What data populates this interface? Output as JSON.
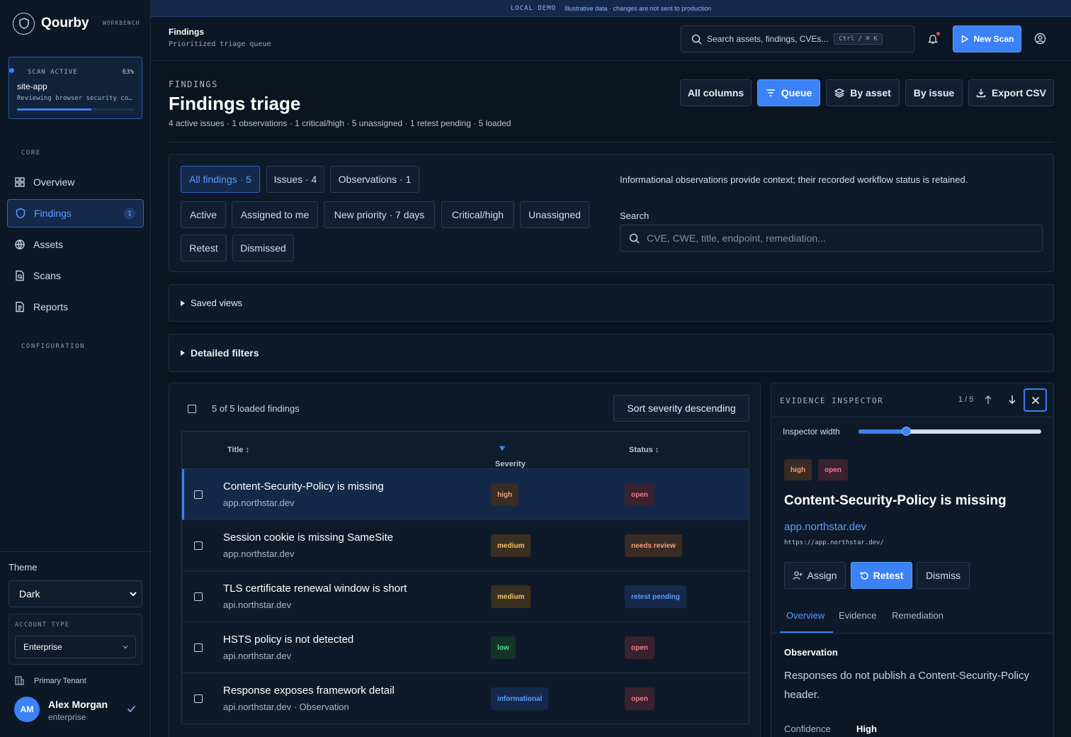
{
  "brand": {
    "name": "Qourby",
    "tag": "WORKBENCH"
  },
  "scan": {
    "status": "SCAN ACTIVE",
    "progress_pct": 63,
    "progress_label": "63%",
    "app": "site-app",
    "description": "Reviewing browser security controls"
  },
  "sidebar": {
    "core_label": "CORE",
    "config_label": "CONFIGURATION",
    "items": [
      {
        "label": "Overview",
        "icon": "grid-icon"
      },
      {
        "label": "Findings",
        "icon": "shield-icon",
        "badge": "1"
      },
      {
        "label": "Assets",
        "icon": "globe-icon"
      },
      {
        "label": "Scans",
        "icon": "file-scan-icon"
      },
      {
        "label": "Reports",
        "icon": "document-icon"
      }
    ],
    "theme_label": "Theme",
    "theme_value": "Dark",
    "account_label": "ACCOUNT TYPE",
    "account_value": "Enterprise",
    "tenant": "Primary Tenant",
    "user": {
      "initials": "AM",
      "name": "Alex Morgan",
      "plan": "enterprise"
    }
  },
  "banner": {
    "tag": "LOCAL DEMO",
    "text": "Illustrative data · changes are not sent to production"
  },
  "header": {
    "title": "Findings",
    "subtitle": "Prioritized triage queue",
    "search_placeholder": "Search assets, findings, CVEs...",
    "shortcut": "Ctrl / ⌘ K",
    "new_scan": "New Scan"
  },
  "page": {
    "eyebrow": "FINDINGS",
    "title": "Findings triage",
    "subtitle": "4 active issues · 1 observations · 1 critical/high · 5 unassigned · 1 retest pending · 5 loaded",
    "views": [
      "All columns",
      "Queue",
      "By asset",
      "By issue",
      "Export CSV"
    ]
  },
  "filters": {
    "scope": [
      "All findings · 5",
      "Issues · 4",
      "Observations · 1"
    ],
    "quick": [
      "Active",
      "Assigned to me",
      "New priority · 7 days",
      "Critical/high",
      "Unassigned",
      "Retest",
      "Dismissed"
    ],
    "note": "Informational observations provide context; their recorded workflow status is retained.",
    "search_label": "Search",
    "search_placeholder": "CVE, CWE, title, endpoint, remediation..."
  },
  "saved_views": "Saved views",
  "detailed_filters": "Detailed filters",
  "table": {
    "count": "5 of 5 loaded findings",
    "sort": "Sort severity descending",
    "columns": {
      "title": "Title ↕",
      "severity": "Severity",
      "status": "Status ↕"
    },
    "rows": [
      {
        "title": "Content-Security-Policy is missing",
        "host": "app.northstar.dev",
        "severity": "high",
        "status": "open"
      },
      {
        "title": "Session cookie is missing SameSite",
        "host": "app.northstar.dev",
        "severity": "medium",
        "status": "needs review"
      },
      {
        "title": "TLS certificate renewal window is short",
        "host": "api.northstar.dev",
        "severity": "medium",
        "status": "retest pending"
      },
      {
        "title": "HSTS policy is not detected",
        "host": "api.northstar.dev",
        "severity": "low",
        "status": "open"
      },
      {
        "title": "Response exposes framework detail",
        "host": "api.northstar.dev · Observation",
        "severity": "informational",
        "status": "open"
      }
    ]
  },
  "inspector": {
    "eyebrow": "EVIDENCE INSPECTOR",
    "position": "1 / 5",
    "width_label": "Inspector width",
    "width_pct": 26,
    "severity": "high",
    "status": "open",
    "title": "Content-Security-Policy is missing",
    "host": "app.northstar.dev",
    "url": "https://app.northstar.dev/",
    "actions": [
      "Assign",
      "Retest",
      "Dismiss"
    ],
    "tabs": [
      "Overview",
      "Evidence",
      "Remediation"
    ],
    "observation_heading": "Observation",
    "observation_text": "Responses do not publish a Content-Security-Policy header.",
    "confidence_label": "Confidence",
    "confidence_value": "High"
  },
  "colors": {
    "accent": "#3b82f6",
    "high": "#f0a07a",
    "medium": "#f5c26b",
    "low": "#4ade9c",
    "informational": "#5b9bff",
    "open": "#f27a8e",
    "retest": "#5b9bff"
  }
}
